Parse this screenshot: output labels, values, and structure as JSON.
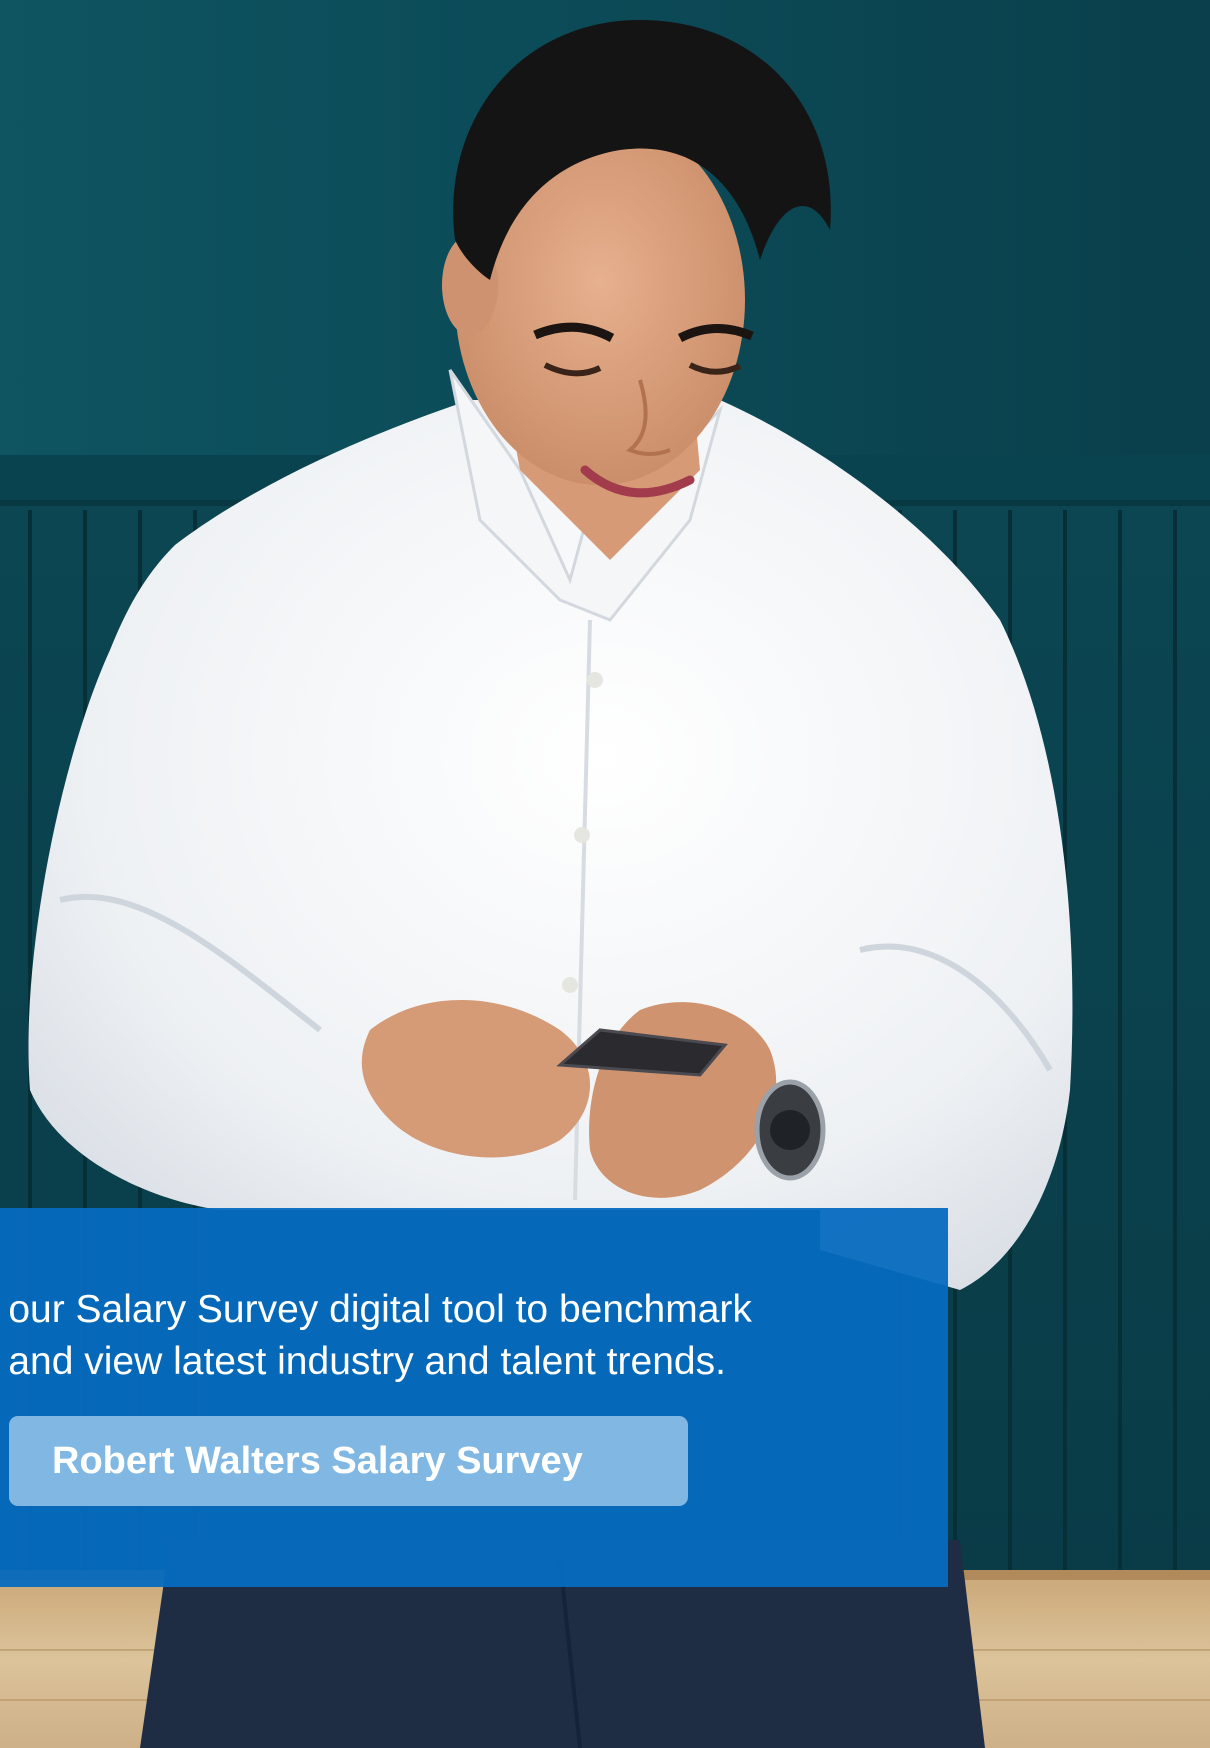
{
  "promo": {
    "line1": "s our Salary Survey digital tool to benchmark",
    "line2": "s and view latest industry and talent trends.",
    "button_label": "Robert Walters Salary Survey"
  },
  "colors": {
    "panel_blue": "#066abf",
    "button_light_blue": "#80b8e3",
    "wall_teal": "#0d4d59",
    "text_white": "#ffffff"
  },
  "icons": [
    "none"
  ]
}
